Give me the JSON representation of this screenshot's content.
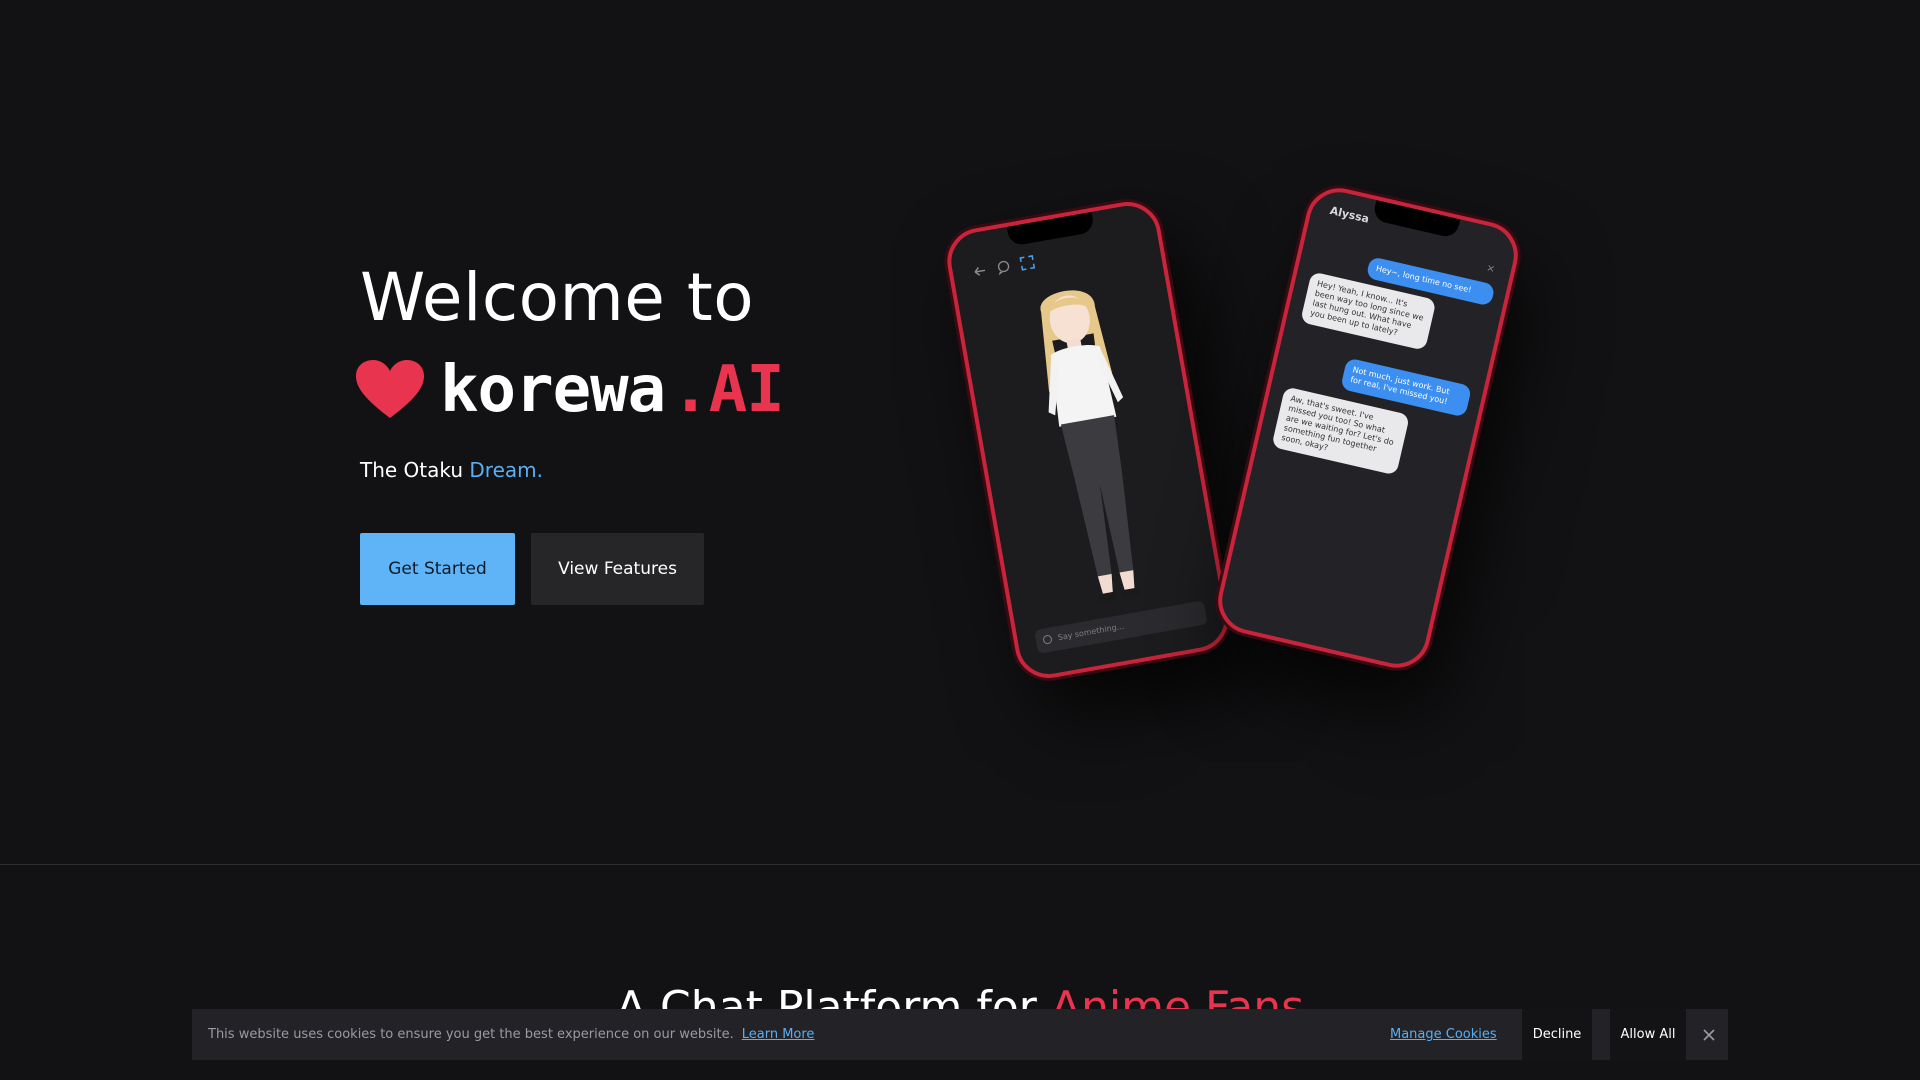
{
  "hero": {
    "title": "Welcome to",
    "brand_name": "korewa",
    "brand_suffix": ".AI",
    "tagline_prefix": "The Otaku ",
    "tagline_accent": "Dream.",
    "primary_button": "Get Started",
    "secondary_button": "View Features"
  },
  "phones": {
    "left": {
      "input_placeholder": "Say something..."
    },
    "right": {
      "contact_name": "Alyssa",
      "close_label": "×",
      "messages": [
        {
          "from": "user",
          "text": "Hey~, long time no see!"
        },
        {
          "from": "ai",
          "text": "Hey! Yeah, I know... It's been way too long since we last hung out. What have you been up to lately?"
        },
        {
          "from": "user",
          "text": "Not much, just work. But for real, I've missed you!"
        },
        {
          "from": "ai",
          "text": "Aw, that's sweet. I've missed you too! So what are we waiting for? Let's do something fun together soon, okay?"
        }
      ]
    }
  },
  "section": {
    "heading_prefix": "A Chat Platform for ",
    "heading_accent": "Anime Fans"
  },
  "cookie_bar": {
    "message": "This website uses cookies to ensure you get the best experience on our website.",
    "learn_more": "Learn More",
    "manage": "Manage Cookies",
    "decline": "Decline",
    "allow_all": "Allow All"
  },
  "colors": {
    "background": "#121214",
    "accent_red": "#e8344f",
    "accent_blue": "#5aaef2",
    "primary_button": "#5fb4f7"
  },
  "icons": [
    "heart-icon",
    "back-icon",
    "chat-icon",
    "expand-icon",
    "close-icon"
  ]
}
